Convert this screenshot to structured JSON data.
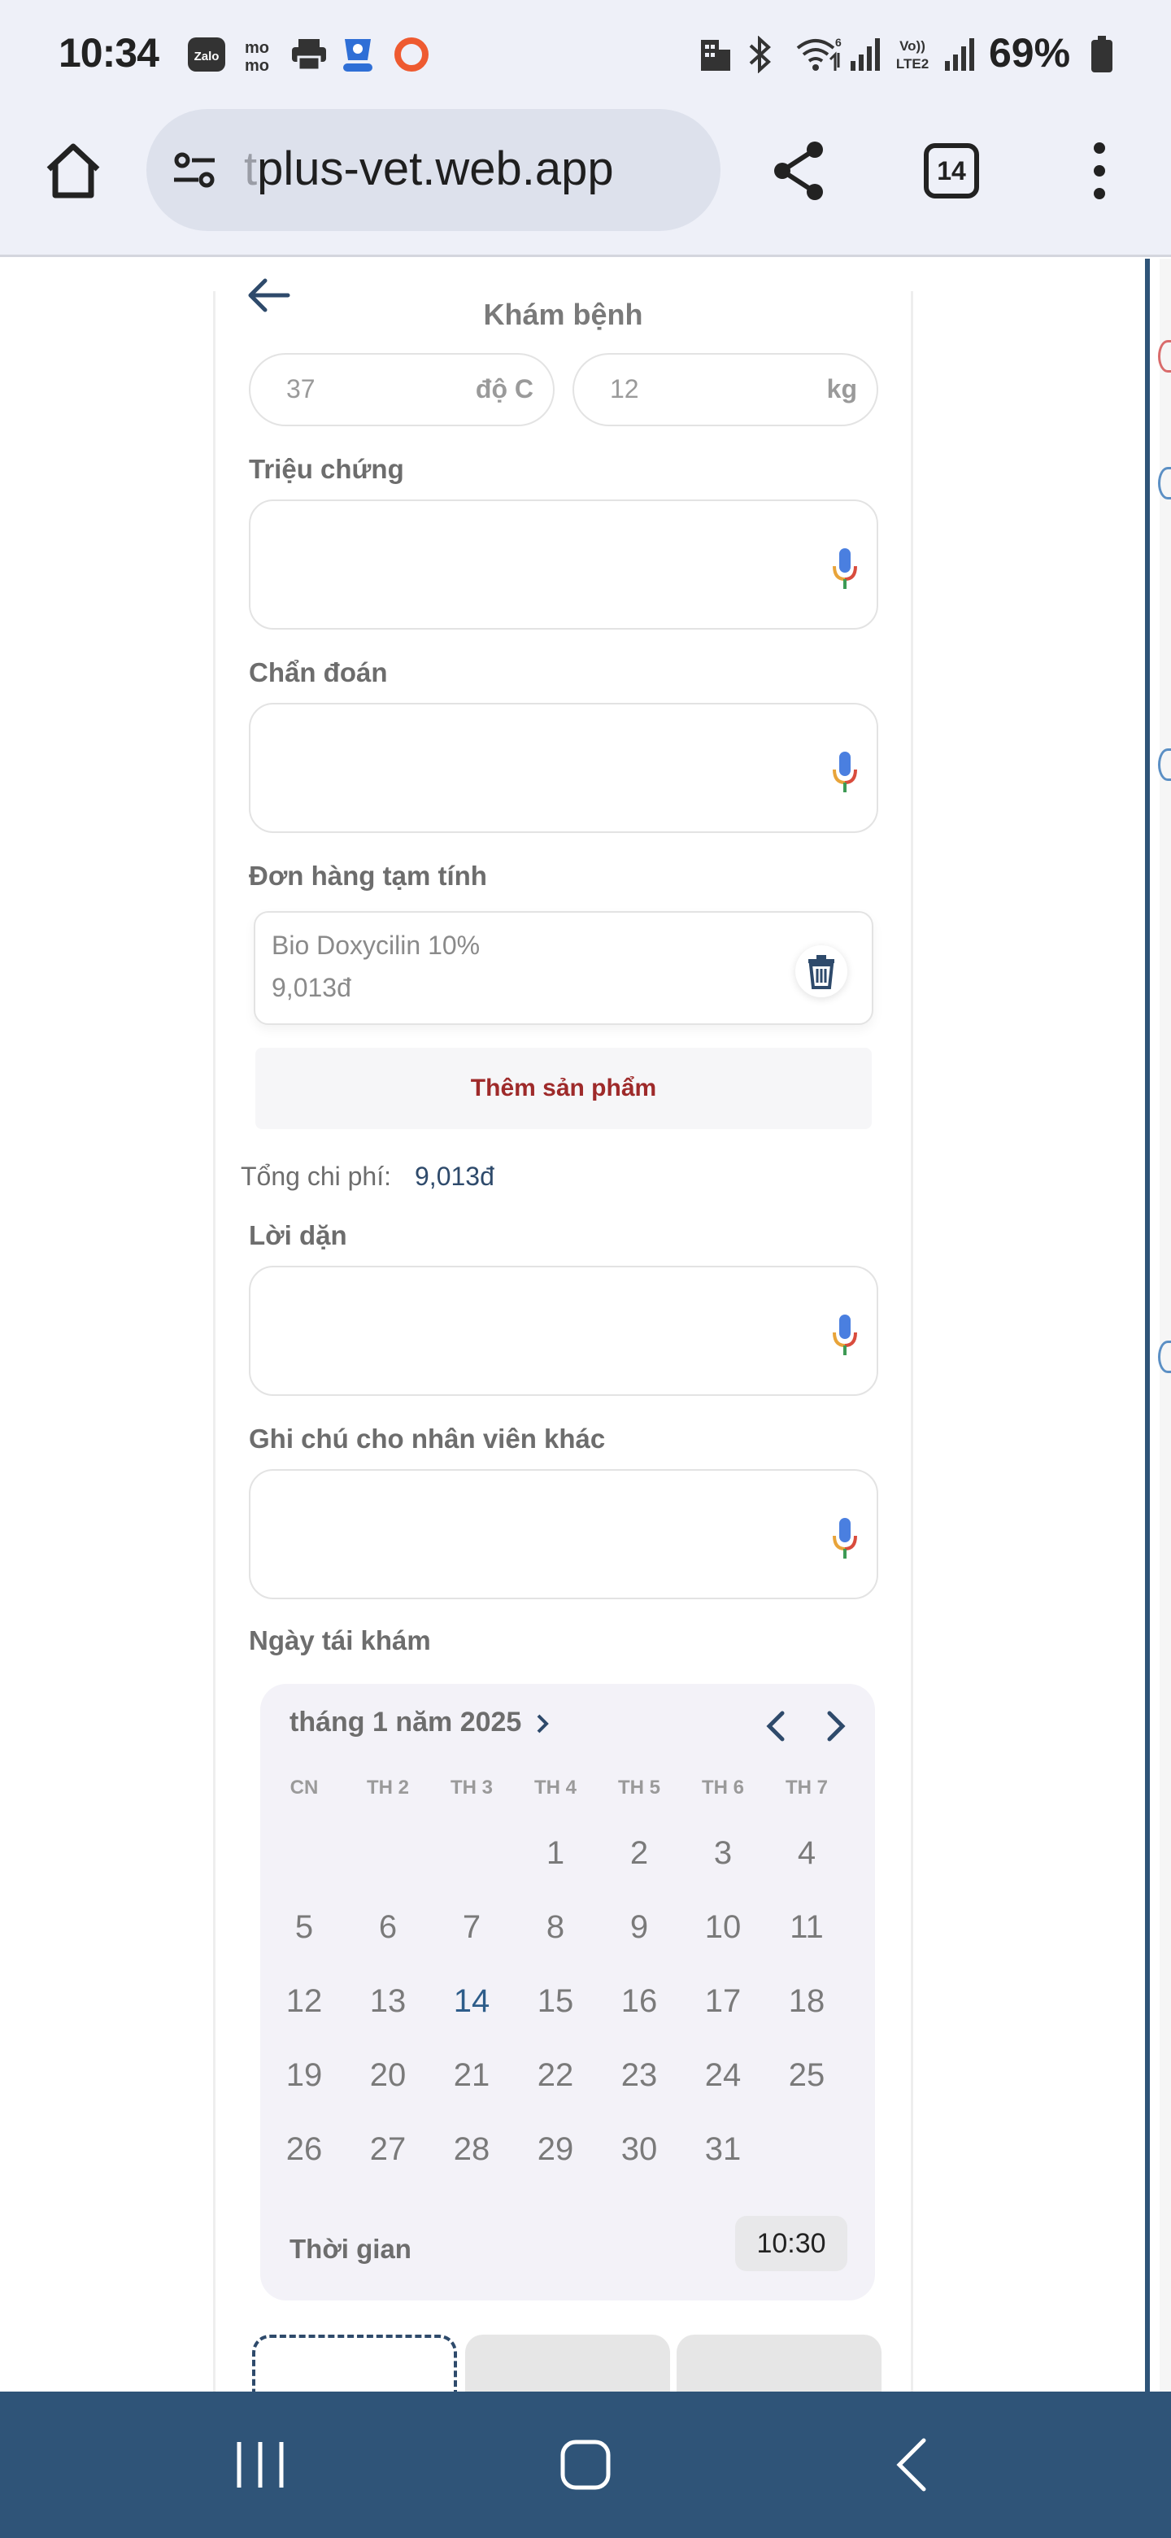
{
  "status_bar": {
    "time": "10:34",
    "app_icons": [
      "zalo-icon",
      "momo-icon",
      "printer-icon",
      "vpn-shield-icon",
      "ring-icon"
    ],
    "system_icons": [
      "building-icon",
      "bluetooth-icon",
      "wifi-icon",
      "signal-icon",
      "volte-icon",
      "signal-icon",
      "battery-icon"
    ],
    "wifi_badge": "6",
    "volte_label": "Vo)) LTE2",
    "battery_percent": "69%"
  },
  "browser": {
    "url_prefix": "t",
    "url_main": "plus-vet.web.app",
    "tab_count": "14"
  },
  "page": {
    "title": "Khám bệnh",
    "temperature": {
      "value": "37",
      "unit": "độ C"
    },
    "weight": {
      "value": "12",
      "unit": "kg"
    },
    "symptoms_label": "Triệu chứng",
    "diagnosis_label": "Chẩn đoán",
    "order_label": "Đơn hàng tạm tính",
    "order_items": [
      {
        "name": "Bio Doxycilin 10%",
        "price": "9,013đ"
      }
    ],
    "add_product_label": "Thêm sản phẩm",
    "total_label": "Tổng chi phí:",
    "total_value": "9,013đ",
    "advice_label": "Lời dặn",
    "staff_note_label": "Ghi chú cho nhân viên khác",
    "revisit_label": "Ngày tái khám"
  },
  "calendar": {
    "month_label": "tháng 1 năm 2025",
    "weekdays": [
      "CN",
      "TH 2",
      "TH 3",
      "TH 4",
      "TH 5",
      "TH 6",
      "TH 7"
    ],
    "weeks": [
      [
        "",
        "",
        "",
        "1",
        "2",
        "3",
        "4"
      ],
      [
        "5",
        "6",
        "7",
        "8",
        "9",
        "10",
        "11"
      ],
      [
        "12",
        "13",
        "14",
        "15",
        "16",
        "17",
        "18"
      ],
      [
        "19",
        "20",
        "21",
        "22",
        "23",
        "24",
        "25"
      ],
      [
        "26",
        "27",
        "28",
        "29",
        "30",
        "31",
        ""
      ]
    ],
    "today": "14",
    "time_label": "Thời gian",
    "time_value": "10:30"
  },
  "colors": {
    "accent": "#2e4a6b",
    "nav_bar": "#2f5478",
    "add_product_text": "#9e2a2a"
  }
}
